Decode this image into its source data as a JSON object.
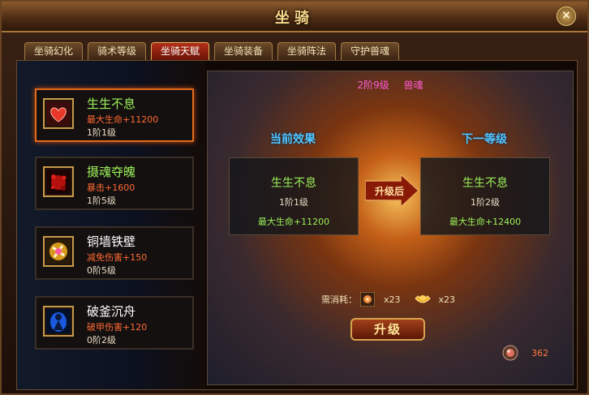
{
  "window": {
    "title": "坐骑",
    "close_glyph": "×"
  },
  "tabs": [
    "坐骑幻化",
    "骑术等级",
    "坐骑天赋",
    "坐骑装备",
    "坐骑阵法",
    "守护兽魂"
  ],
  "active_tab_index": 2,
  "talents": [
    {
      "name": "生生不息",
      "attr": "最大生命+11200",
      "level": "1阶1级",
      "icon": "heart-icon",
      "name_color": "#9cf05a",
      "selected": true
    },
    {
      "name": "摄魂夺魄",
      "attr": "暴击+1600",
      "level": "1阶5级",
      "icon": "red-splash-icon",
      "name_color": "#9cf05a",
      "selected": false
    },
    {
      "name": "铜墙铁壁",
      "attr": "减免伤害+150",
      "level": "0阶5级",
      "icon": "shield-burst-icon",
      "name_color": "#ffffff",
      "selected": false
    },
    {
      "name": "破釜沉舟",
      "attr": "破甲伤害+120",
      "level": "0阶2级",
      "icon": "blue-warrior-icon",
      "name_color": "#ffffff",
      "selected": false
    }
  ],
  "header": {
    "level_text": "2阶9级",
    "title": "兽魂",
    "level_color": "#ff5ad2",
    "title_color": "#ff5ad2"
  },
  "current": {
    "heading": "当前效果",
    "name": "生生不息",
    "level": "1阶1级",
    "attr": "最大生命+11200"
  },
  "next": {
    "heading": "下一等级",
    "name": "生生不息",
    "level": "1阶2级",
    "attr": "最大生命+12400"
  },
  "arrow_label": "升级后",
  "cost": {
    "label": "需消耗：",
    "items": [
      {
        "icon": "soul-orb-icon",
        "qty": "x23"
      },
      {
        "icon": "gold-ingot-icon",
        "qty": "x23"
      }
    ]
  },
  "upgrade_button": "升级",
  "soul_orbs": {
    "icon": "soul-orb-icon",
    "value": "362"
  }
}
